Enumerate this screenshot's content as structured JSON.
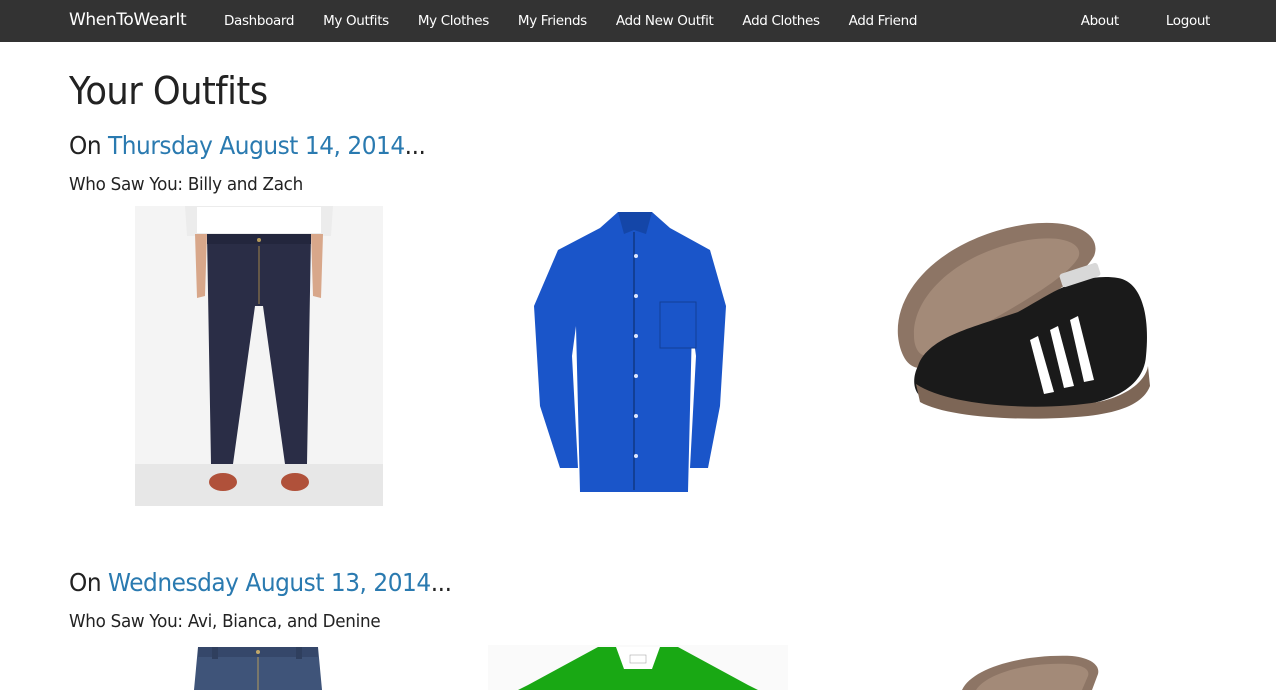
{
  "brand": "WhenToWearIt",
  "nav": {
    "left": [
      "Dashboard",
      "My Outfits",
      "My Clothes",
      "My Friends",
      "Add New Outfit",
      "Add Clothes",
      "Add Friend"
    ],
    "right": [
      "About",
      "Logout"
    ]
  },
  "page_title": "Your Outfits",
  "outfits": [
    {
      "prefix": "On ",
      "date": "Thursday August 14, 2014",
      "suffix": "...",
      "who_saw_label": "Who Saw You: ",
      "who_saw": "Billy and Zach",
      "items": [
        "jeans",
        "blue dress shirt",
        "black sneakers"
      ]
    },
    {
      "prefix": "On ",
      "date": "Wednesday August 13, 2014",
      "suffix": "...",
      "who_saw_label": "Who Saw You: ",
      "who_saw": "Avi, Bianca, and Denine",
      "items": [
        "jeans",
        "green polo shirt",
        "black sneakers"
      ]
    }
  ],
  "colors": {
    "navbar": "#333333",
    "link": "#2a7ab0",
    "text": "#222222"
  }
}
